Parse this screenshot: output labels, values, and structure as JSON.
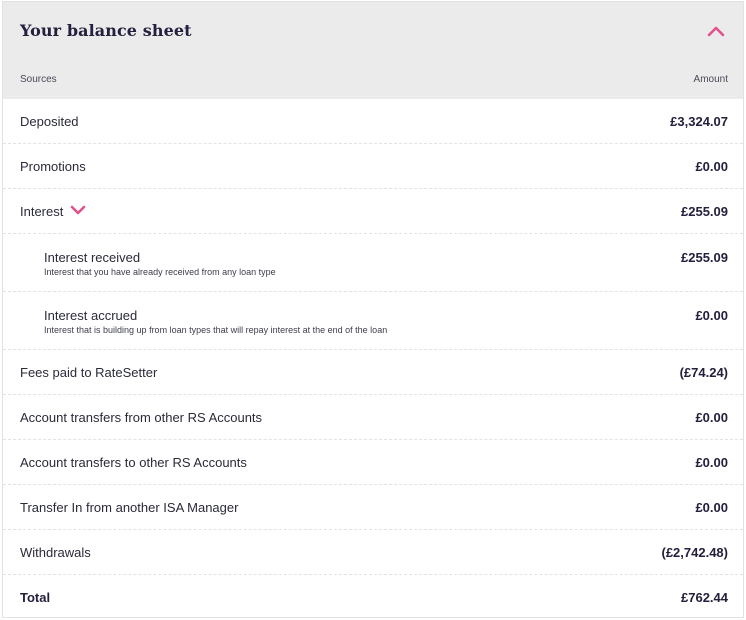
{
  "balance_sheet": {
    "title": "Your balance sheet",
    "collapse_icon": "chevron-up-icon",
    "accent_color": "#e0528c",
    "columns": {
      "sources": "Sources",
      "amount": "Amount"
    },
    "rows": [
      {
        "label": "Deposited",
        "amount": "£3,324.07"
      },
      {
        "label": "Promotions",
        "amount": "£0.00"
      },
      {
        "label": "Interest",
        "amount": "£255.09",
        "expand_icon": "chevron-down-icon"
      },
      {
        "label": "Interest received",
        "description": "Interest that you have already received from any loan type",
        "amount": "£255.09"
      },
      {
        "label": "Interest accrued",
        "description": "Interest that is building up from loan types that will repay interest at the end of the loan",
        "amount": "£0.00"
      },
      {
        "label": "Fees paid to RateSetter",
        "amount": "(£74.24)"
      },
      {
        "label": "Account transfers from other RS Accounts",
        "amount": "£0.00"
      },
      {
        "label": "Account transfers to other RS Accounts",
        "amount": "£0.00"
      },
      {
        "label": "Transfer In from another ISA Manager",
        "amount": "£0.00"
      },
      {
        "label": "Withdrawals",
        "amount": "(£2,742.48)"
      },
      {
        "label": "Total",
        "amount": "£762.44"
      }
    ]
  }
}
